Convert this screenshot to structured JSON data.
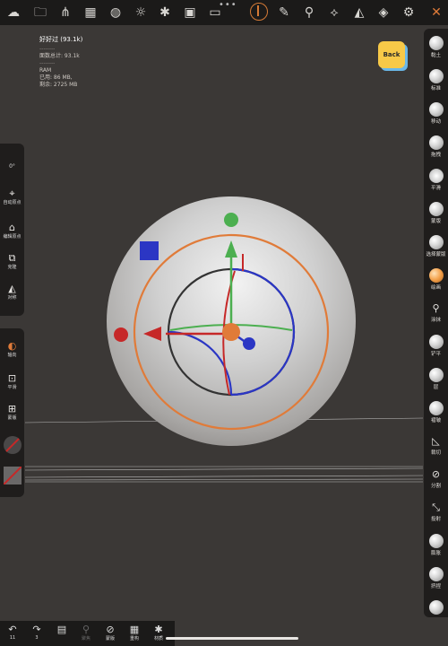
{
  "stats": {
    "title": "好好过 (93.1k)",
    "sep": "--------",
    "total": "面数总计: 93.1k",
    "ram": "RAM",
    "used": "已用:    86 MB,",
    "free": "剩余:  2725 MB"
  },
  "back_button": "Back",
  "topbar_icons": [
    "cloud-icon",
    "folder-icon",
    "scene-icon",
    "grid-icon",
    "globe-icon",
    "sun-icon",
    "material-icon",
    "image-icon",
    "camera-icon",
    "gizmo-icon",
    "brush-icon",
    "eyedropper-icon",
    "symmetry-icon",
    "triangle-icon",
    "layers-icon",
    "settings-icon",
    "tools-icon"
  ],
  "left_panel": {
    "angle": "0°",
    "auto_pivot": "自动原点",
    "edit_pivot": "编辑原点",
    "clone": "克隆",
    "mirror": "对称",
    "axis": "轴向",
    "smooth": "平滑",
    "mask": "蒙版"
  },
  "right_panel": [
    "黏土",
    "标准",
    "移动",
    "拖拽",
    "平滑",
    "蒙版",
    "选择蒙版",
    "绘画",
    "涂抹",
    "铲平",
    "层",
    "褶皱",
    "裁切",
    "分割",
    "投射",
    "膨胀",
    "挤捏"
  ],
  "bottom_bar": {
    "undo_count": "11",
    "redo_count": "3",
    "focus": "聚焦",
    "mask": "蒙版",
    "remesh": "重构",
    "material": "材质"
  },
  "colors": {
    "accent_orange": "#e07b39",
    "gizmo_green": "#4caf50",
    "gizmo_red": "#c62828",
    "gizmo_blue": "#2b36c4",
    "back_yellow": "#f7c948"
  }
}
